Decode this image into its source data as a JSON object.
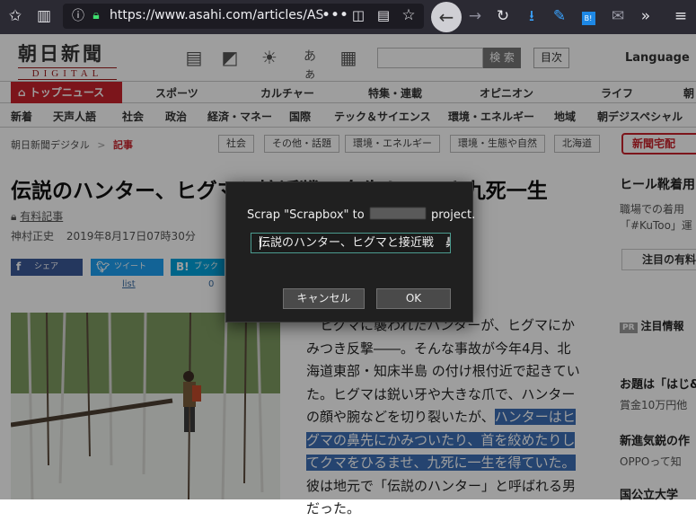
{
  "browser": {
    "url": "https://www.asahi.com/articles/AS",
    "toolbar_icons": [
      "bookmark-star-icon",
      "library-icon",
      "info-icon",
      "lock-icon",
      "more-icon",
      "pocket-icon",
      "reader-icon",
      "star-icon",
      "back-icon",
      "forward-icon",
      "reload-icon",
      "download-icon",
      "attachment-icon",
      "extension-icon",
      "mail-icon",
      "overflow-icon",
      "menu-icon"
    ]
  },
  "site": {
    "logo_main": "朝日新聞",
    "logo_sub": "DIGITAL",
    "search_button": "検 索",
    "mokuji": "目次",
    "language": "Language",
    "aa_icon": "あぁ"
  },
  "nav_primary": [
    "トップニュース",
    "スポーツ",
    "カルチャー",
    "特集・連載",
    "オピニオン",
    "ライフ",
    "朝"
  ],
  "nav_secondary": [
    "新着",
    "天声人語",
    "社会",
    "政治",
    "経済・マネー",
    "国際",
    "テック＆サイエンス",
    "環境・エネルギー",
    "地域",
    "朝デジスペシャル"
  ],
  "breadcrumb": {
    "root": "朝日新聞デジタル",
    "separator": ">",
    "current": "記事"
  },
  "tags": [
    "社会",
    "その他・話題",
    "環境・エネルギー",
    "環境・生態や自然",
    "北海道"
  ],
  "shinbun_button": "新聞宅配",
  "article": {
    "title": "伝説のハンター、ヒグマと接近戦　鼻先かみつき九死一生",
    "paid_label": "有料記事",
    "author": "神村正史",
    "date": "2019年8月17日07時30分",
    "share": [
      {
        "label": "シェア",
        "count": ""
      },
      {
        "label": "ツイート",
        "count": "list"
      },
      {
        "label": "ブックマーク",
        "count": "0"
      }
    ],
    "body_before": "　ヒグマに襲われたハンターが、ヒグマにかみつき反撃――。そんな事故が今年4月、北海道東部・知床半島 の付け根付近で起きていた。ヒグマは鋭い牙や大きな爪で、ハンターの顔や腕などを切り裂いたが、",
    "body_highlight": "ハンターはヒグマの鼻先にかみついたり、首を絞めたりしてクマをひるませ、九死に一生を得ていた。",
    "body_after": "彼は地元で「伝説のハンター」と呼ばれる男だった。"
  },
  "right_column": {
    "heading1": "ヒール靴着用",
    "sub1a": "職場での着用",
    "sub1b": "「#KuToo」運",
    "box1": "注目の有料",
    "pr_label": "PR",
    "pr_text": "注目情報",
    "heading2": "お題は「はじ&",
    "sub2": "賞金10万円他",
    "heading3": "新進気鋭の作",
    "sub3": "OPPOって知",
    "heading4": "国公立大学"
  },
  "dialog": {
    "message_prefix": "Scrap \"Scrapbox\" to",
    "message_suffix": "project.",
    "input_value": "伝説のハンター、ヒグマと接近戦　鼻",
    "cancel_label": "キャンセル",
    "ok_label": "OK"
  }
}
